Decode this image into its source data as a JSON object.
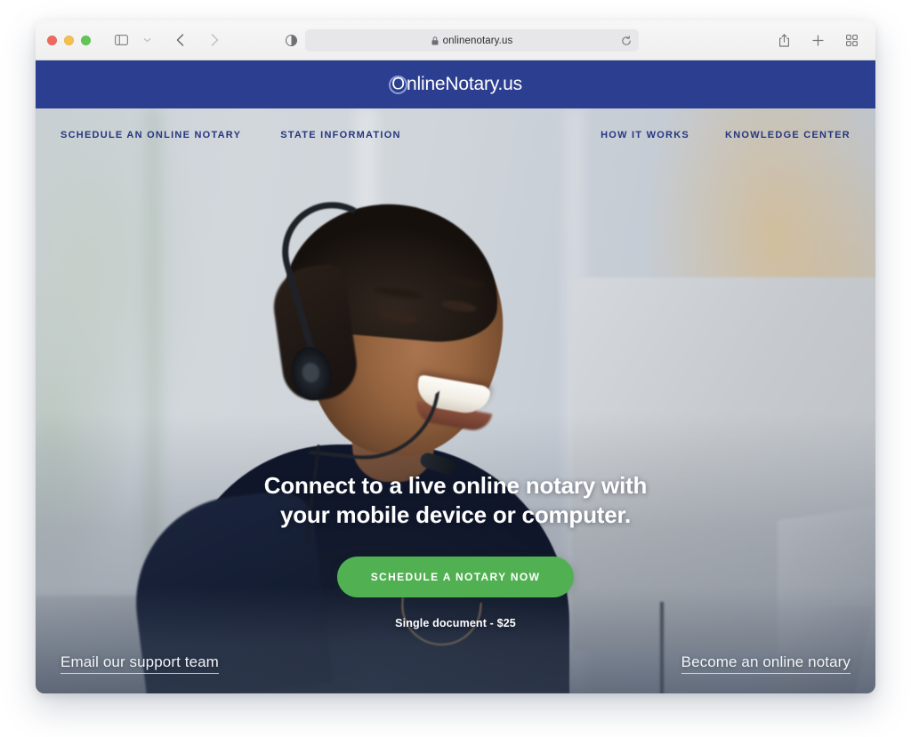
{
  "browser": {
    "url": "onlinenotary.us",
    "lock_icon": "lock-icon",
    "shield_icon": "shield-icon",
    "reload_icon": "reload-icon",
    "sidebar_icon": "sidebar-toggle-icon",
    "chevron_icon": "chevron-down-icon",
    "back_icon": "back-arrow-icon",
    "forward_icon": "forward-arrow-icon",
    "share_icon": "share-icon",
    "newtab_icon": "plus-icon",
    "tabs_icon": "tab-overview-icon"
  },
  "site": {
    "brand": {
      "mark": "O",
      "name": "nlineNotary.us"
    },
    "nav_left": [
      {
        "label": "SCHEDULE AN ONLINE NOTARY"
      },
      {
        "label": "STATE INFORMATION"
      }
    ],
    "nav_right": [
      {
        "label": "HOW IT WORKS"
      },
      {
        "label": "KNOWLEDGE CENTER"
      }
    ],
    "hero": {
      "headline": "Connect to a live online notary with your mobile device or computer.",
      "cta_label": "SCHEDULE A NOTARY NOW",
      "price_note": "Single document - $25"
    },
    "bottom": {
      "support_label": "Email our support team",
      "become_label": "Become an online notary"
    },
    "colors": {
      "header_blue": "#2c3e8f",
      "nav_text": "#25367f",
      "cta_green": "#51b152"
    }
  }
}
